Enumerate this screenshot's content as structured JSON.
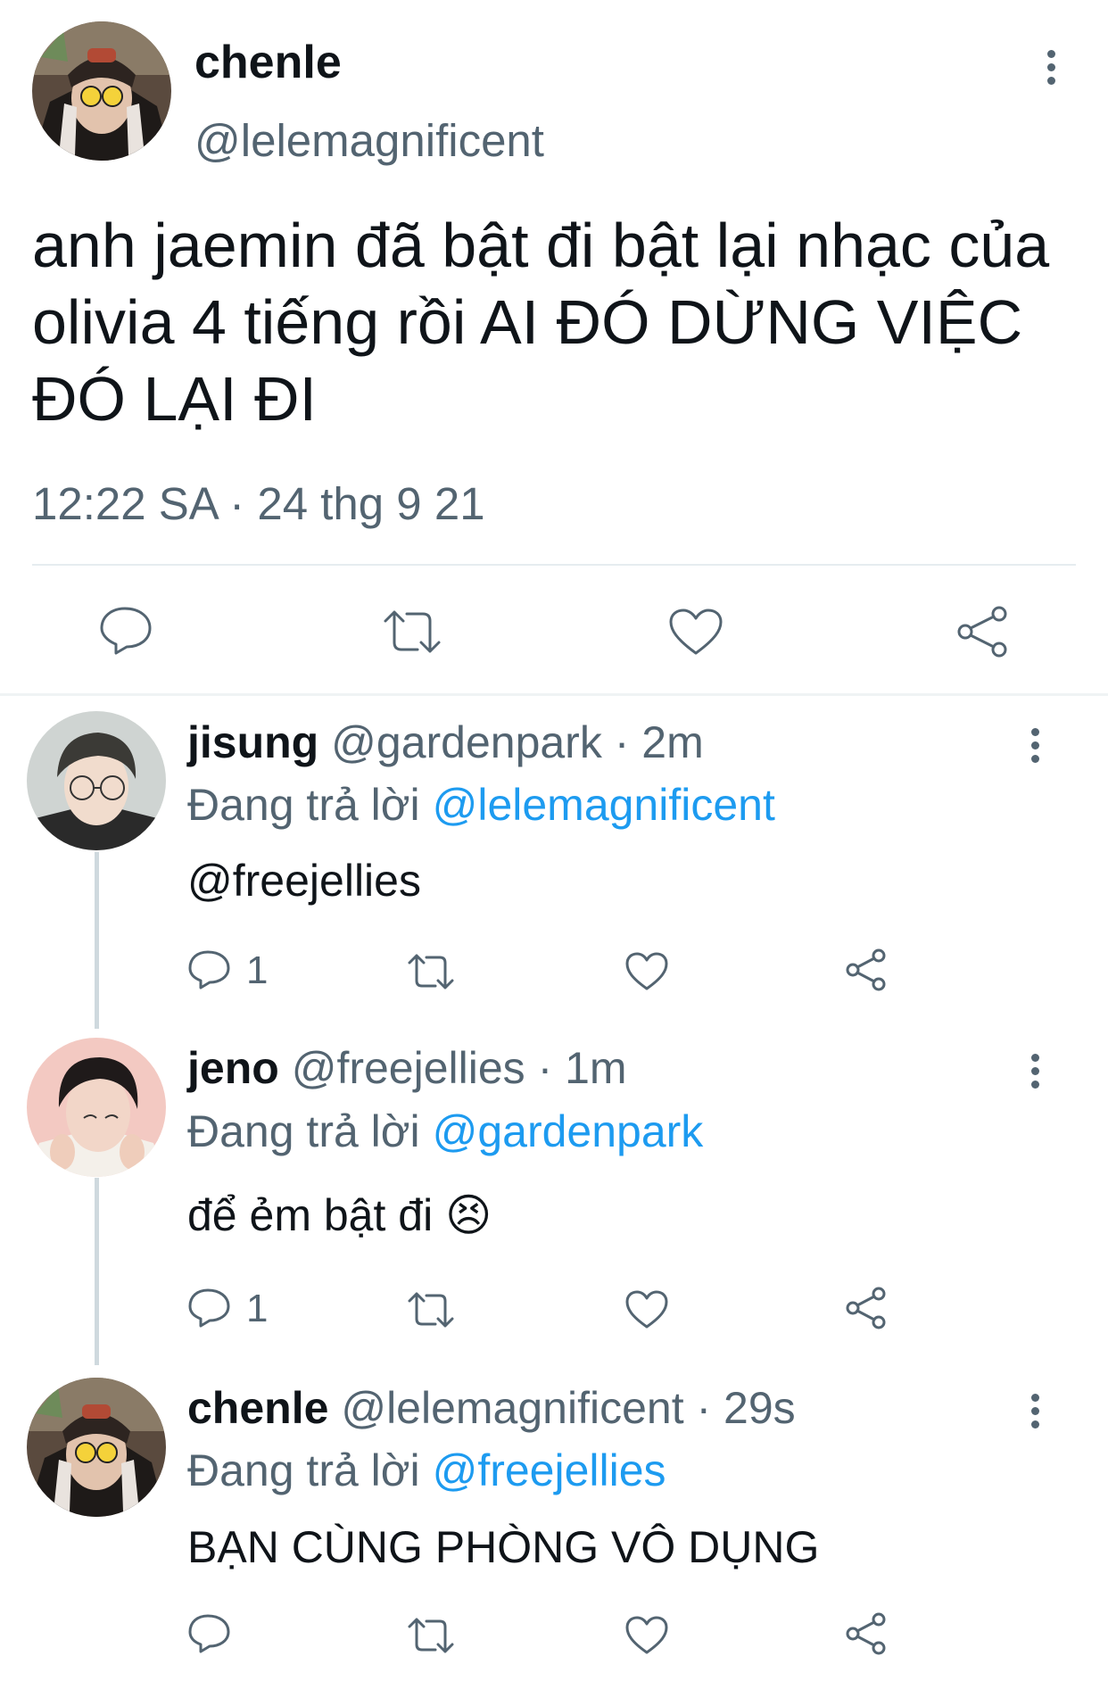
{
  "main_tweet": {
    "name": "chenle",
    "handle": "@lelemagnificent",
    "text": "anh jaemin đã bật đi bật lại nhạc của olivia 4 tiếng rồi AI ĐÓ DỪNG VIỆC ĐÓ LẠI ĐI",
    "timestamp": "12:22 SA · 24 thg 9 21",
    "actions": [
      "reply-icon",
      "retweet-icon",
      "like-icon",
      "share-icon"
    ]
  },
  "replies": [
    {
      "name": "jisung",
      "handle": "@gardenpark",
      "time": "· 2m",
      "replying_label": "Đang trả lời",
      "replying_to": "@lelemagnificent",
      "body_link": "@freejellies",
      "reply_count": "1"
    },
    {
      "name": "jeno",
      "handle": "@freejellies",
      "time": "· 1m",
      "replying_label": "Đang trả lời",
      "replying_to": "@gardenpark",
      "body": "để ẻm bật đi 😣",
      "reply_count": "1"
    },
    {
      "name": "chenle",
      "handle": "@lelemagnificent",
      "time": "· 29s",
      "replying_label": "Đang trả lời",
      "replying_to": "@freejellies",
      "body": "BẠN CÙNG PHÒNG VÔ DỤNG",
      "reply_count": ""
    }
  ],
  "colors": {
    "link": "#1d9bf0",
    "secondary_text": "#536471",
    "primary_text": "#0f1419"
  }
}
